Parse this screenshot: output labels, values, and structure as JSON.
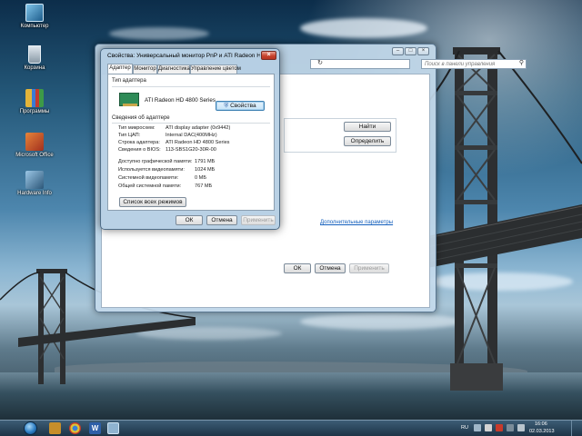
{
  "desktop": {
    "icons": [
      {
        "label": "Компьютер"
      },
      {
        "label": "Корзина"
      },
      {
        "label": "Программы"
      },
      {
        "label": "Microsoft Office"
      },
      {
        "label": "Hardware Info"
      }
    ]
  },
  "control_panel": {
    "search_placeholder": "Поиск в панели управления",
    "find_button": "Найти",
    "detect_button": "Определить",
    "advanced_link": "Дополнительные параметры",
    "ok": "ОК",
    "cancel": "Отмена",
    "apply": "Применить"
  },
  "dialog": {
    "title": "Свойства: Универсальный монитор PnP и ATI Radeon HD 4800 S...",
    "tabs": [
      "Адаптер",
      "Монитор",
      "Диагностика",
      "Управление цветом"
    ],
    "adapter_type_header": "Тип адаптера",
    "adapter_name": "ATI Radeon HD 4800 Series",
    "properties_button": "Свойства",
    "adapter_info_header": "Сведения об адаптере",
    "info_rows": [
      {
        "key": "Тип микросхем:",
        "value": "ATI display adapter (0x9442)"
      },
      {
        "key": "Тип ЦАП:",
        "value": "Internal DAC(400MHz)"
      },
      {
        "key": "Строка адаптера:",
        "value": "ATI Radeon HD 4800 Series"
      },
      {
        "key": "Сведения о BIOS:",
        "value": "113-SBS1G20-30R-00"
      }
    ],
    "memory_rows": [
      {
        "key": "Доступно графической памяти:",
        "value": "1791 МБ"
      },
      {
        "key": "Используется видеопамяти:",
        "value": "1024 МБ"
      },
      {
        "key": "Системной видеопамяти:",
        "value": "0 МБ"
      },
      {
        "key": "Общей системной памяти:",
        "value": "767 МБ"
      }
    ],
    "list_modes_button": "Список всех режимов",
    "ok": "ОК",
    "cancel": "Отмена",
    "apply": "Применить"
  },
  "taskbar": {
    "language": "RU",
    "time": "16:06",
    "date": "02.03.2013"
  }
}
